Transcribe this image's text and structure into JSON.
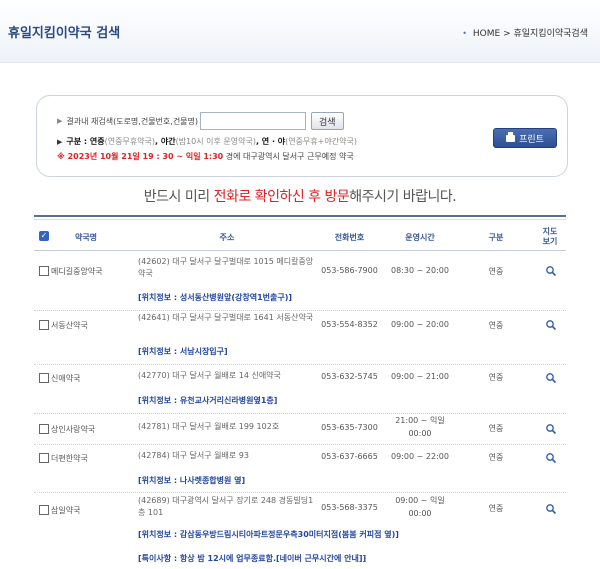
{
  "page_title": "휴일지킴이약국 검색",
  "breadcrumb": "HOME > 휴일지킴이약국검색",
  "search": {
    "label": "결과내 재검색(도로명,건물번호,건물명)",
    "input_value": "",
    "button": "검색",
    "legend_label": "구분 : ",
    "legend_a": "연중",
    "legend_a_note": "(연중무휴약국)",
    "legend_b": ", 야간",
    "legend_b_note": "(밤10시 이후 운영약국)",
    "legend_c": ", 연 · 야",
    "legend_c_note": "(연중무휴+야간약국)",
    "date_text": "※ 2023년 10월 21일 19 : 30 ~ 익일 1:30",
    "date_rest": " 경에  대구광역시  달서구   근무예정 약국",
    "print": "프린트"
  },
  "notice": {
    "pre": "반드시 미리 ",
    "highlight": "전화로 확인하신 후 방문",
    "post": "해주시기 바랍니다."
  },
  "table": {
    "headers": {
      "name": "약국명",
      "addr": "주소",
      "phone": "전화번호",
      "hours": "운영시간",
      "type": "구분",
      "map1": "지도",
      "map2": "보기"
    },
    "rows": [
      {
        "name": "메디길중앙약국",
        "addr": "(42602) 대구 달서구 달구벌대로 1015 메디칼중앙약국",
        "phone": "053-586-7900",
        "hours": "08:30 ~ 20:00",
        "type": "연중",
        "location": "[위치정보 : 성서동산병원앞(강창역1번출구)]"
      },
      {
        "name": "서동산약국",
        "addr": "(42641) 대구 달서구 달구벌대로 1641 서동산약국",
        "phone": "053-554-8352",
        "hours": "09:00 ~ 20:00",
        "type": "연중",
        "location": "[위치정보 : 서남시장입구]"
      },
      {
        "name": "신애약국",
        "addr": "(42770) 대구 달서구 월배로 14 신애약국",
        "phone": "053-632-5745",
        "hours": "09:00 ~ 21:00",
        "type": "연중",
        "location": "[위치정보 : 유천교사거리신라병원옆1층]"
      },
      {
        "name": "상인사랑약국",
        "addr": "(42781) 대구 달서구 월배로 199 102호",
        "phone": "053-635-7300",
        "hours_1": "21:00 ~ 익일",
        "hours_2": "00:00",
        "type": "연중",
        "location": ""
      },
      {
        "name": "더편한약국",
        "addr": "(42784) 대구 달서구 월배로 93",
        "phone": "053-637-6665",
        "hours": "09:00 ~ 22:00",
        "type": "연중",
        "location": "[위치정보 : 나사렛종합병원 옆]"
      },
      {
        "name": "삼일약국",
        "addr": "(42689) 대구광역시 달서구 장기로 248 경동빌딩1층 101",
        "phone": "053-568-3375",
        "hours_1": "09:00 ~ 익일",
        "hours_2": "00:00",
        "type": "연중",
        "location": "[위치정보 : 감삼동우방드림시티아파트정문우측30미터지점(봄봄 커피점 옆)]",
        "special": "[특이사항 : 항상 밤 12시에 업무종료함.[네이버 근무시간에 안내]]"
      }
    ]
  },
  "colors": {
    "accent": "#2b4a86",
    "warning": "#e02222",
    "link": "#2346a0"
  }
}
